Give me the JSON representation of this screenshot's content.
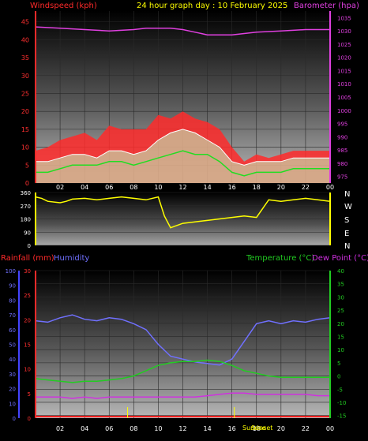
{
  "header": {
    "title": "24 hour graph day : 10 February 2025",
    "left_label": "Windspeed (kph)",
    "right_label": "Barometer (hpa)"
  },
  "wind_dir_panel": {
    "compass": [
      "N",
      "W",
      "S",
      "E",
      "N"
    ]
  },
  "bottom_header": {
    "rain_label": "Rainfall (mm)",
    "humidity_label": "Humidity",
    "temp_label": "Temperature (°C)",
    "dew_label": "Dew Point (°C)"
  },
  "sun_labels": {
    "sunrise": "Sunrise",
    "sunset": "Sunset"
  },
  "colors": {
    "windspeed": "#ff2a2a",
    "wind_avg": "#22dd22",
    "wind_gust_fill": "#b9ffc6",
    "barometer": "#e040e0",
    "wind_direction": "#ffff00",
    "humidity": "#7070ff",
    "temperature": "#22cc22",
    "dew_point": "#d030e0",
    "rainfall": "#ff2020",
    "rain_axis": "#4444ff"
  },
  "chart_data": [
    {
      "type": "line",
      "name": "windspeed-barometer",
      "x_ticks": [
        "02",
        "04",
        "06",
        "08",
        "10",
        "12",
        "14",
        "16",
        "18",
        "20",
        "22",
        "00"
      ],
      "y_left_ticks": [
        "0",
        "5",
        "10",
        "15",
        "20",
        "25",
        "30",
        "35",
        "40",
        "45"
      ],
      "y_right_ticks": [
        "975",
        "980",
        "985",
        "990",
        "995",
        "1000",
        "1005",
        "1010",
        "1015",
        "1020",
        "1025",
        "1030",
        "1035"
      ],
      "ylim_left": [
        0,
        48
      ],
      "ylim_right": [
        972.5,
        1037.5
      ],
      "x_range_hours": [
        0,
        24
      ],
      "series": [
        {
          "name": "Windspeed",
          "x": [
            0,
            1,
            2,
            3,
            4,
            5,
            6,
            7,
            8,
            9,
            10,
            11,
            12,
            13,
            14,
            15,
            16,
            17,
            18,
            19,
            20,
            21,
            22,
            23,
            24
          ],
          "values": [
            6,
            6,
            7,
            8,
            8,
            7,
            9,
            9,
            8,
            9,
            12,
            14,
            15,
            14,
            12,
            10,
            6,
            5,
            6,
            6,
            6,
            7,
            7,
            7,
            7
          ]
        },
        {
          "name": "Gust",
          "x": [
            0,
            1,
            2,
            3,
            4,
            5,
            6,
            7,
            8,
            9,
            10,
            11,
            12,
            13,
            14,
            15,
            16,
            17,
            18,
            19,
            20,
            21,
            22,
            23,
            24
          ],
          "values": [
            9,
            10,
            12,
            13,
            14,
            12,
            16,
            15,
            15,
            15,
            19,
            18,
            20,
            18,
            17,
            15,
            10,
            6,
            8,
            7,
            8,
            9,
            9,
            9,
            9
          ]
        },
        {
          "name": "Average",
          "x": [
            0,
            1,
            2,
            3,
            4,
            5,
            6,
            7,
            8,
            9,
            10,
            11,
            12,
            13,
            14,
            15,
            16,
            17,
            18,
            19,
            20,
            21,
            22,
            23,
            24
          ],
          "values": [
            3,
            3,
            4,
            5,
            5,
            5,
            6,
            6,
            5,
            6,
            7,
            8,
            9,
            8,
            8,
            6,
            3,
            2,
            3,
            3,
            3,
            4,
            4,
            4,
            4
          ]
        },
        {
          "name": "Barometer",
          "x": [
            0,
            2,
            4,
            6,
            8,
            9,
            10,
            11,
            12,
            13,
            14,
            15,
            16,
            17,
            18,
            20,
            22,
            24
          ],
          "values": [
            1031.5,
            1031,
            1030.5,
            1030,
            1030.5,
            1031,
            1031,
            1031,
            1030.5,
            1029.5,
            1028.5,
            1028.5,
            1028.5,
            1029,
            1029.5,
            1030,
            1030.5,
            1030.5
          ]
        }
      ]
    },
    {
      "type": "line",
      "name": "wind-direction",
      "y_ticks": [
        "0",
        "90",
        "180",
        "270",
        "360"
      ],
      "ylim": [
        0,
        360
      ],
      "x_range_hours": [
        0,
        24
      ],
      "series": [
        {
          "name": "Wind direction",
          "x": [
            0,
            0.5,
            1,
            2,
            2.5,
            3,
            4,
            5,
            6,
            7,
            8,
            9,
            10,
            10.5,
            11,
            12,
            13,
            14,
            15,
            16,
            17,
            18,
            19,
            20,
            21,
            22,
            23,
            24
          ],
          "values": [
            330,
            320,
            300,
            290,
            300,
            315,
            320,
            310,
            320,
            330,
            320,
            310,
            330,
            200,
            120,
            150,
            160,
            170,
            180,
            190,
            200,
            190,
            310,
            300,
            310,
            320,
            310,
            300
          ]
        }
      ]
    },
    {
      "type": "line",
      "name": "humidity-temperature-dewpoint-rain",
      "x_ticks": [
        "02",
        "04",
        "06",
        "08",
        "10",
        "12",
        "14",
        "16",
        "18",
        "20",
        "22",
        "00"
      ],
      "y_left_outer_ticks": [
        "0",
        "10",
        "20",
        "30",
        "40",
        "50",
        "60",
        "70",
        "80",
        "90",
        "100"
      ],
      "y_left_inner_ticks": [
        "0",
        "5",
        "10",
        "15",
        "20",
        "25",
        "30"
      ],
      "y_right_ticks": [
        "-15",
        "-10",
        "-5",
        "0",
        "5",
        "10",
        "15",
        "20",
        "25",
        "30",
        "35",
        "40"
      ],
      "ylim_temperature": [
        -16,
        40
      ],
      "ylim_humidity": [
        0,
        100
      ],
      "x_range_hours": [
        0,
        24
      ],
      "series": [
        {
          "name": "Humidity",
          "x": [
            0,
            1,
            2,
            3,
            4,
            5,
            6,
            7,
            8,
            9,
            10,
            11,
            12,
            13,
            14,
            15,
            16,
            17,
            18,
            19,
            20,
            21,
            22,
            23,
            24
          ],
          "values": [
            66,
            65,
            68,
            70,
            67,
            66,
            68,
            67,
            64,
            60,
            50,
            42,
            40,
            38,
            37,
            36,
            40,
            52,
            64,
            66,
            64,
            66,
            65,
            67,
            68
          ]
        },
        {
          "name": "Temperature (°C)",
          "x": [
            0,
            1,
            2,
            3,
            4,
            5,
            6,
            7,
            8,
            9,
            10,
            11,
            12,
            13,
            14,
            15,
            16,
            17,
            18,
            19,
            20,
            21,
            22,
            23,
            24
          ],
          "values": [
            -1,
            -1.5,
            -2,
            -2.5,
            -2,
            -2,
            -1.5,
            -1,
            0,
            2,
            4,
            5,
            5.5,
            5.5,
            6,
            5.5,
            4,
            2,
            1,
            0,
            -0.5,
            -0.5,
            -0.5,
            -0.5,
            -0.5
          ]
        },
        {
          "name": "Dew Point (°C)",
          "x": [
            0,
            1,
            2,
            3,
            4,
            5,
            6,
            7,
            8,
            9,
            10,
            11,
            12,
            13,
            14,
            15,
            16,
            17,
            18,
            19,
            20,
            21,
            22,
            23,
            24
          ],
          "values": [
            -8,
            -8,
            -8,
            -8.5,
            -8,
            -8.5,
            -8,
            -8,
            -8,
            -8,
            -8,
            -8,
            -8,
            -8,
            -7.5,
            -7,
            -6.5,
            -6.5,
            -7,
            -7,
            -7,
            -7,
            -7,
            -7.5,
            -7.5
          ]
        },
        {
          "name": "Rainfall (mm)",
          "x": [
            0,
            24
          ],
          "values": [
            0,
            0
          ]
        }
      ]
    }
  ]
}
